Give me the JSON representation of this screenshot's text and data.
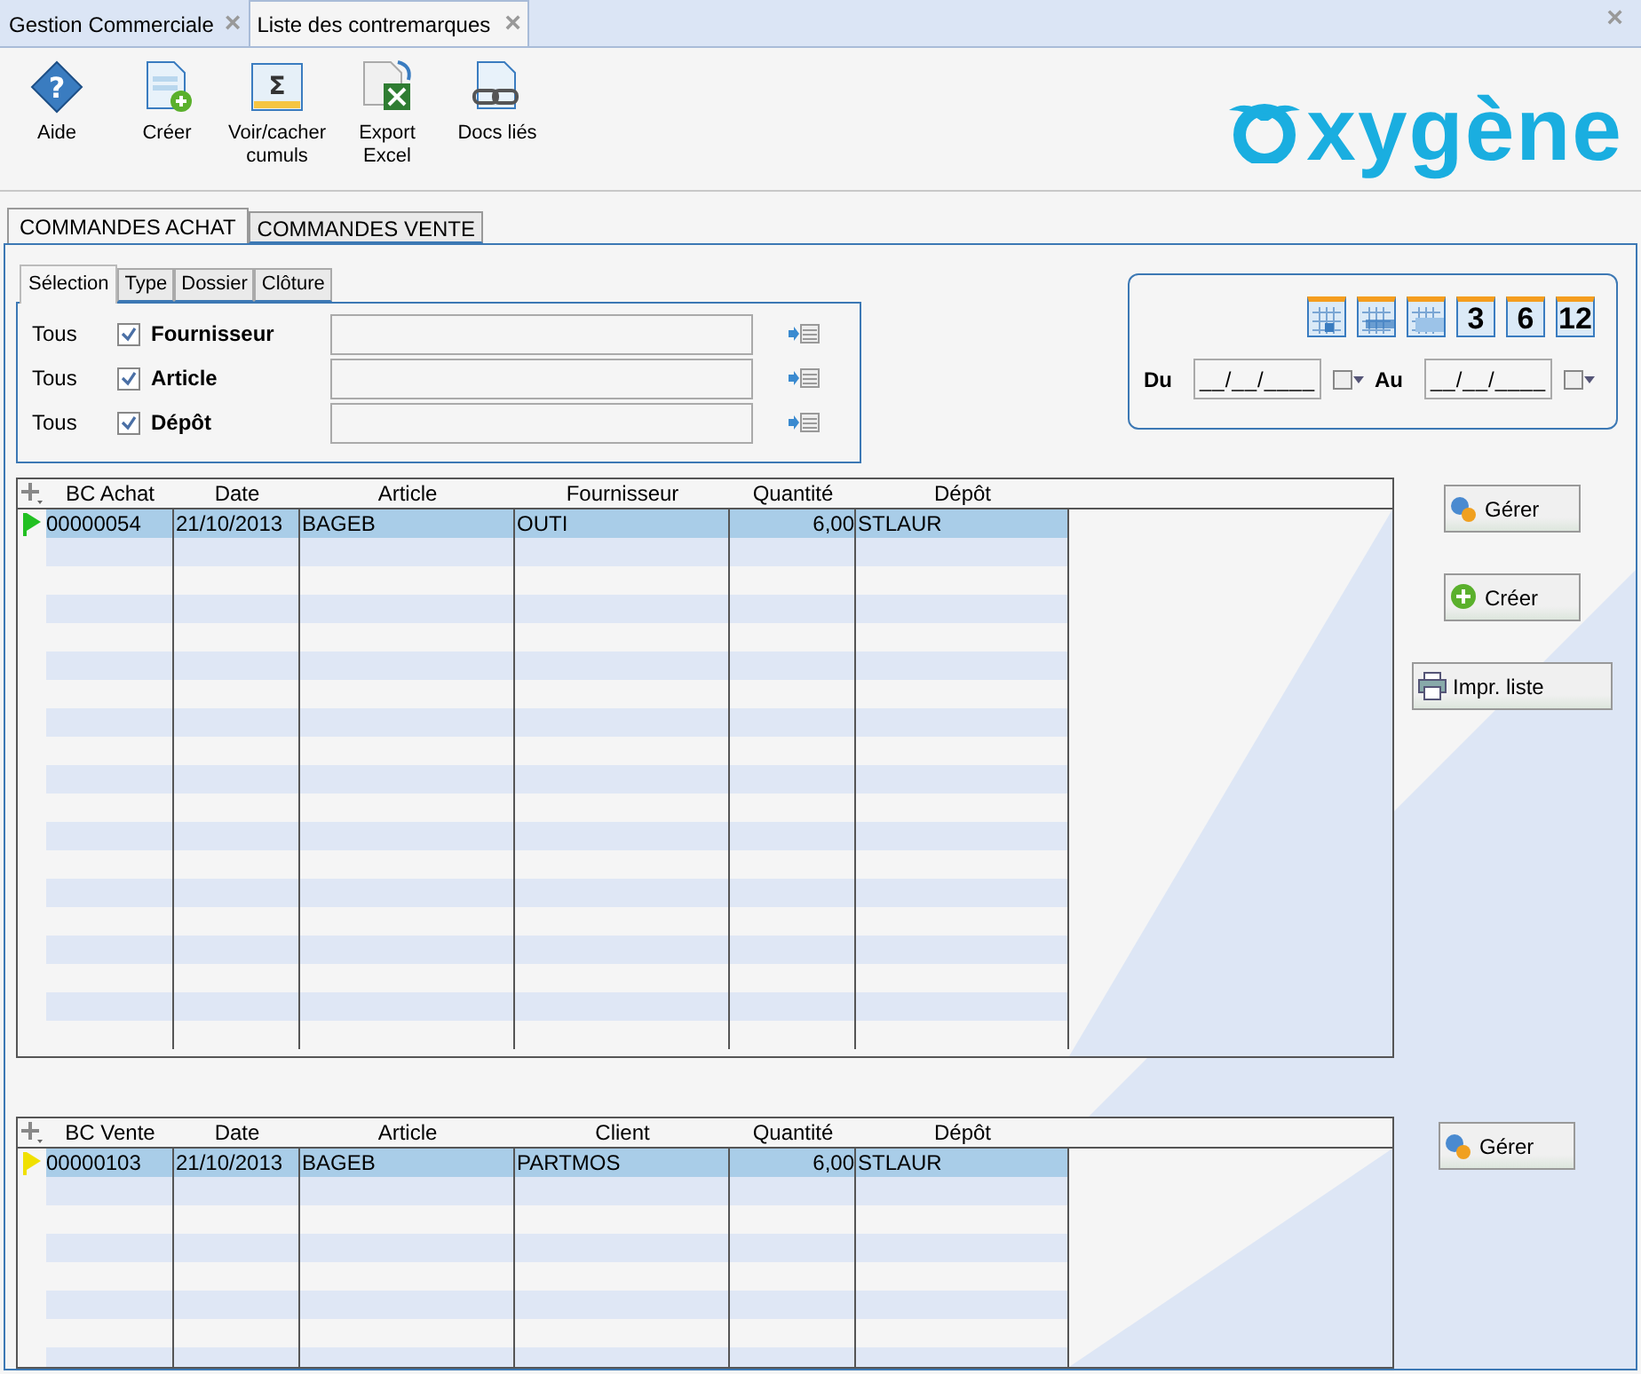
{
  "doc_tabs": [
    {
      "label": "Gestion Commerciale",
      "selected": false,
      "close": "×"
    },
    {
      "label": "Liste des contremarques",
      "selected": true,
      "close": "×"
    }
  ],
  "window_close": "×",
  "toolbar": [
    {
      "kind": "help",
      "glyph": "?",
      "label": "Aide"
    },
    {
      "kind": "create",
      "label": "Créer"
    },
    {
      "kind": "sum",
      "glyph": "Σ",
      "label": "Voir/cacher cumuls"
    },
    {
      "kind": "excel",
      "label": "Export Excel"
    },
    {
      "kind": "link",
      "label": "Docs liés"
    }
  ],
  "logo": {
    "text": "xygène"
  },
  "main_tabs": [
    {
      "label": "COMMANDES ACHAT",
      "selected": true
    },
    {
      "label": "COMMANDES VENTE",
      "selected": false
    }
  ],
  "sub_tabs": [
    {
      "label": "Sélection",
      "selected": true
    },
    {
      "label": "Type",
      "selected": false
    },
    {
      "label": "Dossier",
      "selected": false
    },
    {
      "label": "Clôture",
      "selected": false
    }
  ],
  "filters": [
    {
      "all": "Tous",
      "checked": true,
      "label": "Fournisseur"
    },
    {
      "all": "Tous",
      "checked": true,
      "label": "Article"
    },
    {
      "all": "Tous",
      "checked": true,
      "label": "Dépôt"
    }
  ],
  "period_buttons": [
    {
      "kind": "day"
    },
    {
      "kind": "week"
    },
    {
      "kind": "month"
    },
    {
      "kind": "num",
      "label": "3"
    },
    {
      "kind": "num",
      "label": "6"
    },
    {
      "kind": "num",
      "label": "12"
    }
  ],
  "date_range": {
    "from_label": "Du",
    "from_value": "__/__/____",
    "to_label": "Au",
    "to_value": "__/__/____"
  },
  "purchase_table": {
    "columns": [
      "BC Achat",
      "Date",
      "Article",
      "Fournisseur",
      "Quantité",
      "Dépôt"
    ],
    "rows": [
      {
        "color": "#22c022",
        "cells": [
          "00000054",
          "21/10/2013",
          "BAGEB",
          "OUTI",
          "6,00",
          "STLAUR"
        ],
        "selected": true
      }
    ]
  },
  "purchase_buttons": [
    {
      "kind": "manage",
      "label": "Gérer"
    },
    {
      "kind": "create",
      "label": "Créer"
    },
    {
      "kind": "print",
      "label": "Impr. liste"
    }
  ],
  "sales_table": {
    "columns": [
      "BC Vente",
      "Date",
      "Article",
      "Client",
      "Quantité",
      "Dépôt"
    ],
    "rows": [
      {
        "color": "#f0e000",
        "cells": [
          "00000103",
          "21/10/2013",
          "BAGEB",
          "PARTMOS",
          "6,00",
          "STLAUR"
        ],
        "selected": true
      }
    ]
  },
  "sales_buttons": [
    {
      "kind": "manage",
      "label": "Gérer"
    }
  ]
}
